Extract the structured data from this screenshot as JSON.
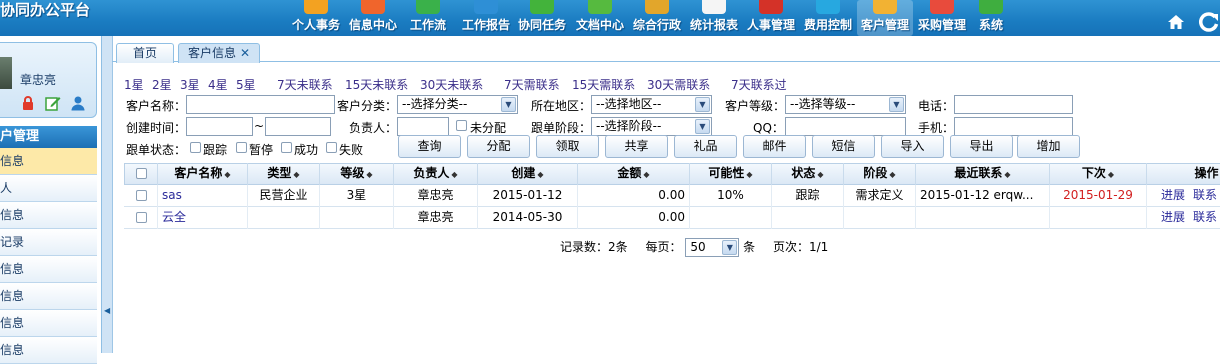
{
  "header": {
    "app_title": "协同办公平台",
    "nav": [
      {
        "label": "个人事务",
        "icon": "personal-affairs-icon",
        "color": "#f3a221"
      },
      {
        "label": "信息中心",
        "icon": "info-center-icon",
        "color": "#f0652c"
      },
      {
        "label": "工作流",
        "icon": "workflow-icon",
        "color": "#3ab14a"
      },
      {
        "label": "工作报告",
        "icon": "work-report-icon",
        "color": "#2e8fd6"
      },
      {
        "label": "协同任务",
        "icon": "collab-task-icon",
        "color": "#43b33b"
      },
      {
        "label": "文档中心",
        "icon": "document-center-icon",
        "color": "#56ba3f"
      },
      {
        "label": "综合行政",
        "icon": "admin-icon",
        "color": "#e2a62b"
      },
      {
        "label": "统计报表",
        "icon": "stats-report-icon",
        "color": "#f5f5f5"
      },
      {
        "label": "人事管理",
        "icon": "hr-icon",
        "color": "#d43228"
      },
      {
        "label": "费用控制",
        "icon": "expense-icon",
        "color": "#27a8e0"
      },
      {
        "label": "客户管理",
        "icon": "customer-icon",
        "color": "#f2b233"
      },
      {
        "label": "采购管理",
        "icon": "purchase-icon",
        "color": "#e84b3c"
      },
      {
        "label": "系统",
        "icon": "system-icon",
        "color": "#3fae3f"
      }
    ],
    "active_nav": "客户管理"
  },
  "sidebar": {
    "user_name": "章忠亮",
    "menu_title": "户管理",
    "items": [
      "信息",
      "人",
      "信息",
      "记录",
      "信息",
      "信息",
      "信息",
      "信息"
    ]
  },
  "tabs": [
    {
      "label": "首页"
    },
    {
      "label": "客户信息",
      "close": "✕"
    }
  ],
  "quick_filters": [
    "1星",
    "2星",
    "3星",
    "4星",
    "5星",
    "7天未联系",
    "15天未联系",
    "30天未联系",
    "7天需联系",
    "15天需联系",
    "30天需联系",
    "7天联系过"
  ],
  "filters": {
    "customer_name_label": "客户名称：",
    "customer_type_label": "客户分类：",
    "customer_type_value": "--选择分类--",
    "region_label": "所在地区：",
    "region_value": "--选择地区--",
    "grade_label": "客户等级：",
    "grade_value": "--选择等级--",
    "phone_label": "电话：",
    "created_label": "创建时间：",
    "created_sep": "~",
    "owner_label": "负责人：",
    "unassigned_label": "未分配",
    "stage_label": "跟单阶段：",
    "stage_value": "--选择阶段--",
    "qq_label": "QQ：",
    "mobile_label": "手机：",
    "status_label": "跟单状态：",
    "status_options": [
      "跟踪",
      "暂停",
      "成功",
      "失败"
    ]
  },
  "actions": [
    "查询",
    "分配",
    "领取",
    "共享",
    "礼品",
    "邮件",
    "短信",
    "导入",
    "导出",
    "增加"
  ],
  "table": {
    "sort_icon": "◆",
    "columns": [
      "客户名称",
      "类型",
      "等级",
      "负责人",
      "创建",
      "金额",
      "可能性",
      "状态",
      "阶段",
      "最近联系",
      "下次",
      "操作"
    ],
    "rows": [
      {
        "name": "sas",
        "type": "民营企业",
        "grade": "3星",
        "owner": "章忠亮",
        "created": "2015-01-12",
        "amount": "0.00",
        "probability": "10%",
        "status": "跟踪",
        "stage": "需求定义",
        "last_contact": "2015-01-12 erqw...",
        "next": "2015-01-29",
        "ops": [
          "进展",
          "联系"
        ]
      },
      {
        "name": "云全",
        "type": "",
        "grade": "",
        "owner": "章忠亮",
        "created": "2014-05-30",
        "amount": "0.00",
        "probability": "",
        "status": "",
        "stage": "",
        "last_contact": "",
        "next": "",
        "ops": [
          "进展",
          "联系"
        ]
      }
    ]
  },
  "pager": {
    "count_label": "记录数：2条",
    "per_page_label": "每页：",
    "per_page_value": "50",
    "per_page_unit": "条",
    "page_label": "页次：1/1"
  }
}
